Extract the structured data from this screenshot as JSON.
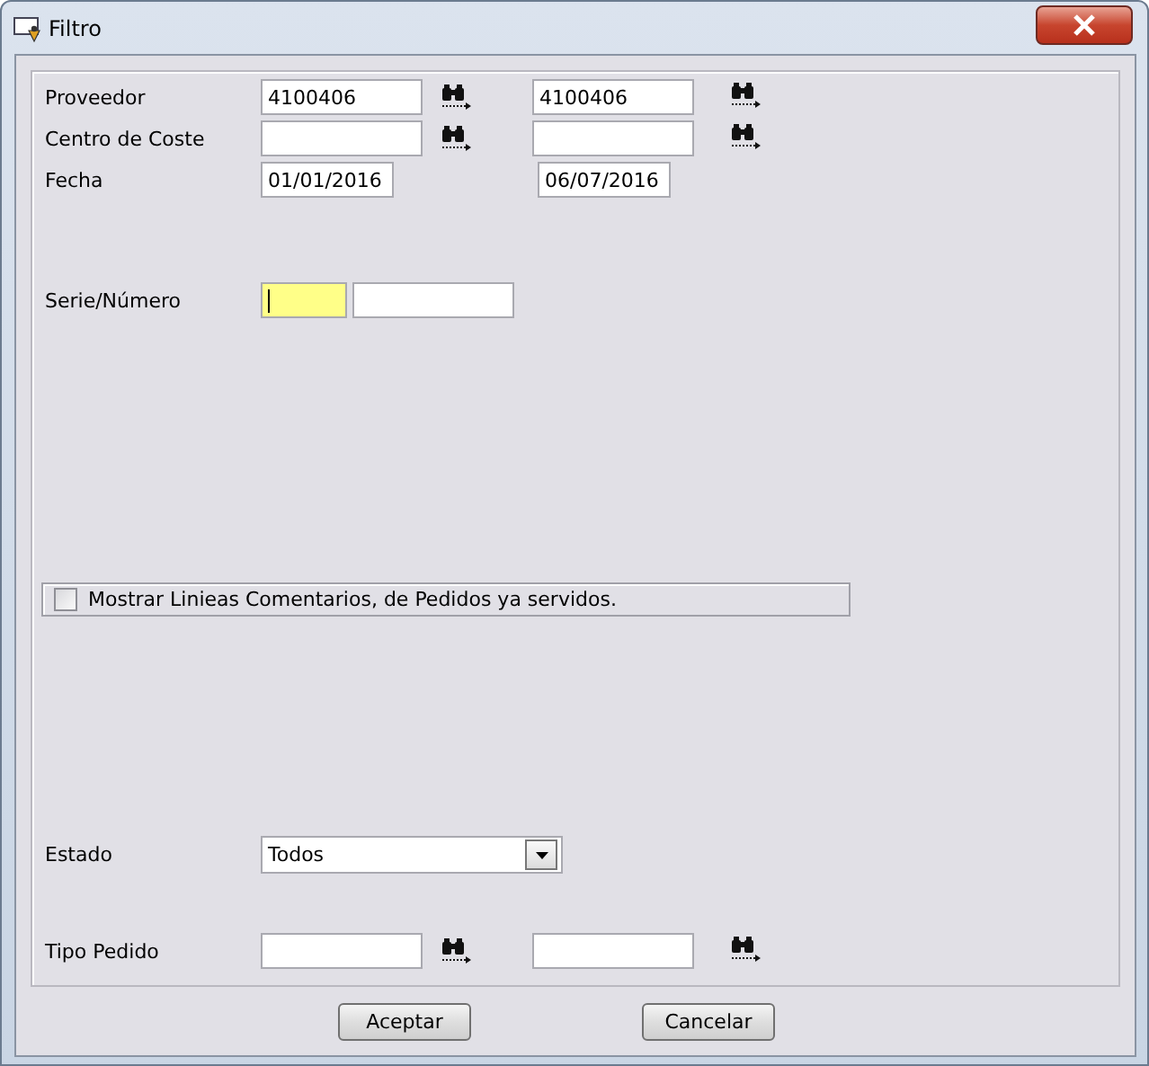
{
  "window": {
    "title": "Filtro"
  },
  "rows": [
    {
      "kind": "lookup_range",
      "label": "Proveedor",
      "from": "4100406",
      "to": "4100406"
    },
    {
      "kind": "lookup_range",
      "label": "Centro de Coste"
    },
    {
      "kind": "date_range",
      "label": "Fecha",
      "from": "01/01/2016",
      "to": "06/07/2016"
    },
    {
      "kind": "serie",
      "label": "Serie/Número",
      "focused": true
    },
    {
      "kind": "checkbox",
      "label": "Mostrar Linieas Comentarios, de Pedidos ya servidos.",
      "checked": false
    },
    {
      "kind": "select",
      "label": "Estado",
      "value": "Todos"
    },
    {
      "kind": "lookup_range",
      "label": "Tipo Pedido"
    }
  ],
  "buttons": [
    {
      "label": "Aceptar"
    },
    {
      "label": "Cancelar"
    }
  ]
}
